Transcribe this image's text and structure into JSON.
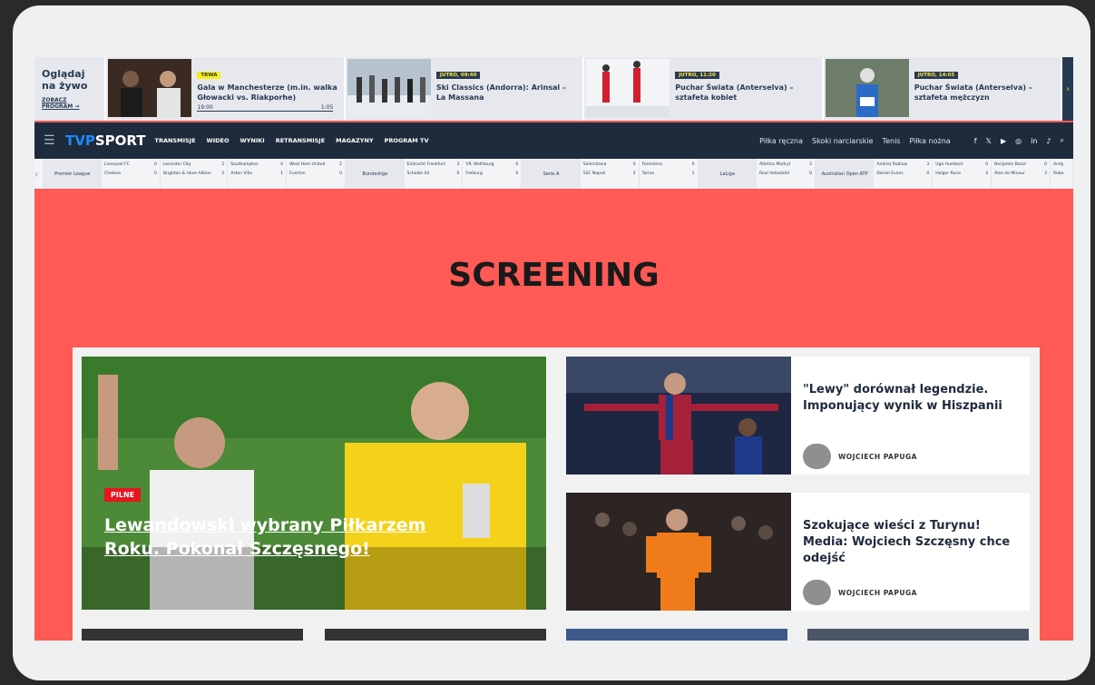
{
  "live": {
    "label_line1": "Oglądaj",
    "label_line2": "na żywo",
    "program_link": "ZOBACZ PROGRAM →",
    "items": [
      {
        "badge": "TRWA",
        "badge_style": "yellow",
        "title": "Gala w Manchesterze (m.in. walka Głowacki vs. Riakporhe)",
        "start": "19:00",
        "end": "1:05",
        "progress": 0.4
      },
      {
        "badge": "JUTRO, 09:40",
        "badge_style": "dark",
        "title": "Ski Classics (Andorra): Arinsal – La Massana"
      },
      {
        "badge": "JUTRO, 11:20",
        "badge_style": "dark",
        "title": "Puchar Świata (Anterselva) – sztafeta kobiet"
      },
      {
        "badge": "JUTRO, 14:05",
        "badge_style": "dark",
        "title": "Puchar Świata (Anterselva) – sztafeta mężczyzn"
      }
    ]
  },
  "header": {
    "logo_tvp": "TVP",
    "logo_sport": "SPORT",
    "nav_left": [
      "TRANSMISJE",
      "WIDEO",
      "WYNIKI",
      "RETRANSMISJE",
      "MAGAZYNY",
      "PROGRAM TV"
    ],
    "nav_right": [
      "Piłka ręczna",
      "Skoki narciarskie",
      "Tenis",
      "Piłka nożna"
    ],
    "social": [
      "f",
      "t",
      "yt",
      "ig",
      "in",
      "tt",
      "search"
    ]
  },
  "results": {
    "groups": [
      {
        "league": "Premier League",
        "matches": [
          {
            "home": "Liverpool FC",
            "hs": "0",
            "away": "Chelsea",
            "as": "0"
          },
          {
            "home": "Leicester City",
            "hs": "2",
            "away": "Brighton & Hove Albion",
            "as": "2"
          },
          {
            "home": "Southampton",
            "hs": "0",
            "away": "Aston Villa",
            "as": "1"
          },
          {
            "home": "West Ham United",
            "hs": "2",
            "away": "Everton",
            "as": "0"
          }
        ]
      },
      {
        "league": "Bundesliga",
        "matches": [
          {
            "home": "Eintracht Frankfurt",
            "hs": "3",
            "away": "Schalke 04",
            "as": "0"
          },
          {
            "home": "VfL Wolfsburg",
            "hs": "6",
            "away": "Freiburg",
            "as": "0"
          }
        ]
      },
      {
        "league": "Serie A",
        "matches": [
          {
            "home": "Salernitana",
            "hs": "0",
            "away": "SSC Napoli",
            "as": "2"
          },
          {
            "home": "Fiorentina",
            "hs": "0",
            "away": "Torino",
            "as": "1"
          }
        ]
      },
      {
        "league": "LaLiga",
        "matches": [
          {
            "home": "Atletico Madryt",
            "hs": "3",
            "away": "Real Valladolid",
            "as": "0"
          }
        ]
      },
      {
        "league": "Australian Open ATP",
        "matches": [
          {
            "home": "Andriej Rublow",
            "hs": "3",
            "away": "Daniel Evans",
            "as": "0"
          },
          {
            "home": "Ugo Humbert",
            "hs": "0",
            "away": "Holger Rune",
            "as": "3"
          },
          {
            "home": "Benjamin Bonzi",
            "hs": "0",
            "away": "Alex de Minaur",
            "as": "3"
          },
          {
            "home": "Andy",
            "hs": "",
            "away": "Robe",
            "as": ""
          }
        ]
      }
    ]
  },
  "hero_title": "SCREENING",
  "main_story": {
    "badge": "PILNE",
    "title": "Lewandowski wybrany Piłkarzem Roku. Pokonał Szczęsnego!"
  },
  "side_stories": [
    {
      "title": "\"Lewy\" dorównał legendzie. Imponujący wynik w Hiszpanii",
      "author": "WOJCIECH PAPUGA"
    },
    {
      "title": "Szokujące wieści z Turynu! Media: Wojciech Szczęsny chce odejść",
      "author": "WOJCIECH PAPUGA"
    }
  ],
  "colors": {
    "accent": "#ff5a55",
    "navy": "#1e2b3c",
    "live_badge": "#f4f018",
    "pilne": "#e8141e"
  }
}
